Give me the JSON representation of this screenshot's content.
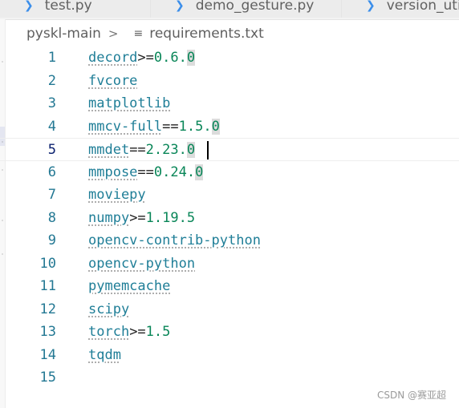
{
  "tabs": [
    {
      "label": "test.py",
      "icon": "python-file-icon"
    },
    {
      "label": "demo_gesture.py",
      "icon": "python-file-icon"
    },
    {
      "label": "version_uti",
      "icon": "python-file-icon"
    }
  ],
  "breadcrumb": {
    "folder": "pyskl-main",
    "file": "requirements.txt"
  },
  "editor": {
    "current_line": 5,
    "lines": [
      {
        "number": "1",
        "name": "decord",
        "op": ">=",
        "ver_main": "0.6.",
        "ver_last": "0"
      },
      {
        "number": "2",
        "name": "fvcore",
        "op": "",
        "ver_main": "",
        "ver_last": ""
      },
      {
        "number": "3",
        "name": "matplotlib",
        "op": "",
        "ver_main": "",
        "ver_last": ""
      },
      {
        "number": "4",
        "name": "mmcv-full",
        "op": "==",
        "ver_main": "1.5.",
        "ver_last": "0"
      },
      {
        "number": "5",
        "name": "mmdet",
        "op": "==",
        "ver_main": "2.23.",
        "ver_last": "0"
      },
      {
        "number": "6",
        "name": "mmpose",
        "op": "==",
        "ver_main": "0.24.",
        "ver_last": "0"
      },
      {
        "number": "7",
        "name": "moviepy",
        "op": "",
        "ver_main": "",
        "ver_last": ""
      },
      {
        "number": "8",
        "name": "numpy",
        "op": ">=",
        "ver_main": "1.19.5",
        "ver_last": ""
      },
      {
        "number": "9",
        "name": "opencv-contrib-python",
        "op": "",
        "ver_main": "",
        "ver_last": ""
      },
      {
        "number": "10",
        "name": "opencv-python",
        "op": "",
        "ver_main": "",
        "ver_last": ""
      },
      {
        "number": "11",
        "name": "pymemcache",
        "op": "",
        "ver_main": "",
        "ver_last": ""
      },
      {
        "number": "12",
        "name": "scipy",
        "op": "",
        "ver_main": "",
        "ver_last": ""
      },
      {
        "number": "13",
        "name": "torch",
        "op": ">=",
        "ver_main": "1.5",
        "ver_last": ""
      },
      {
        "number": "14",
        "name": "tqdm",
        "op": "",
        "ver_main": "",
        "ver_last": ""
      },
      {
        "number": "15",
        "name": "",
        "op": "",
        "ver_main": "",
        "ver_last": ""
      }
    ]
  },
  "watermark": "CSDN @赛亚超",
  "colors": {
    "package": "#1f7e97",
    "version": "#098658",
    "line_number": "#237893",
    "highlight": "#dcdcdc"
  }
}
